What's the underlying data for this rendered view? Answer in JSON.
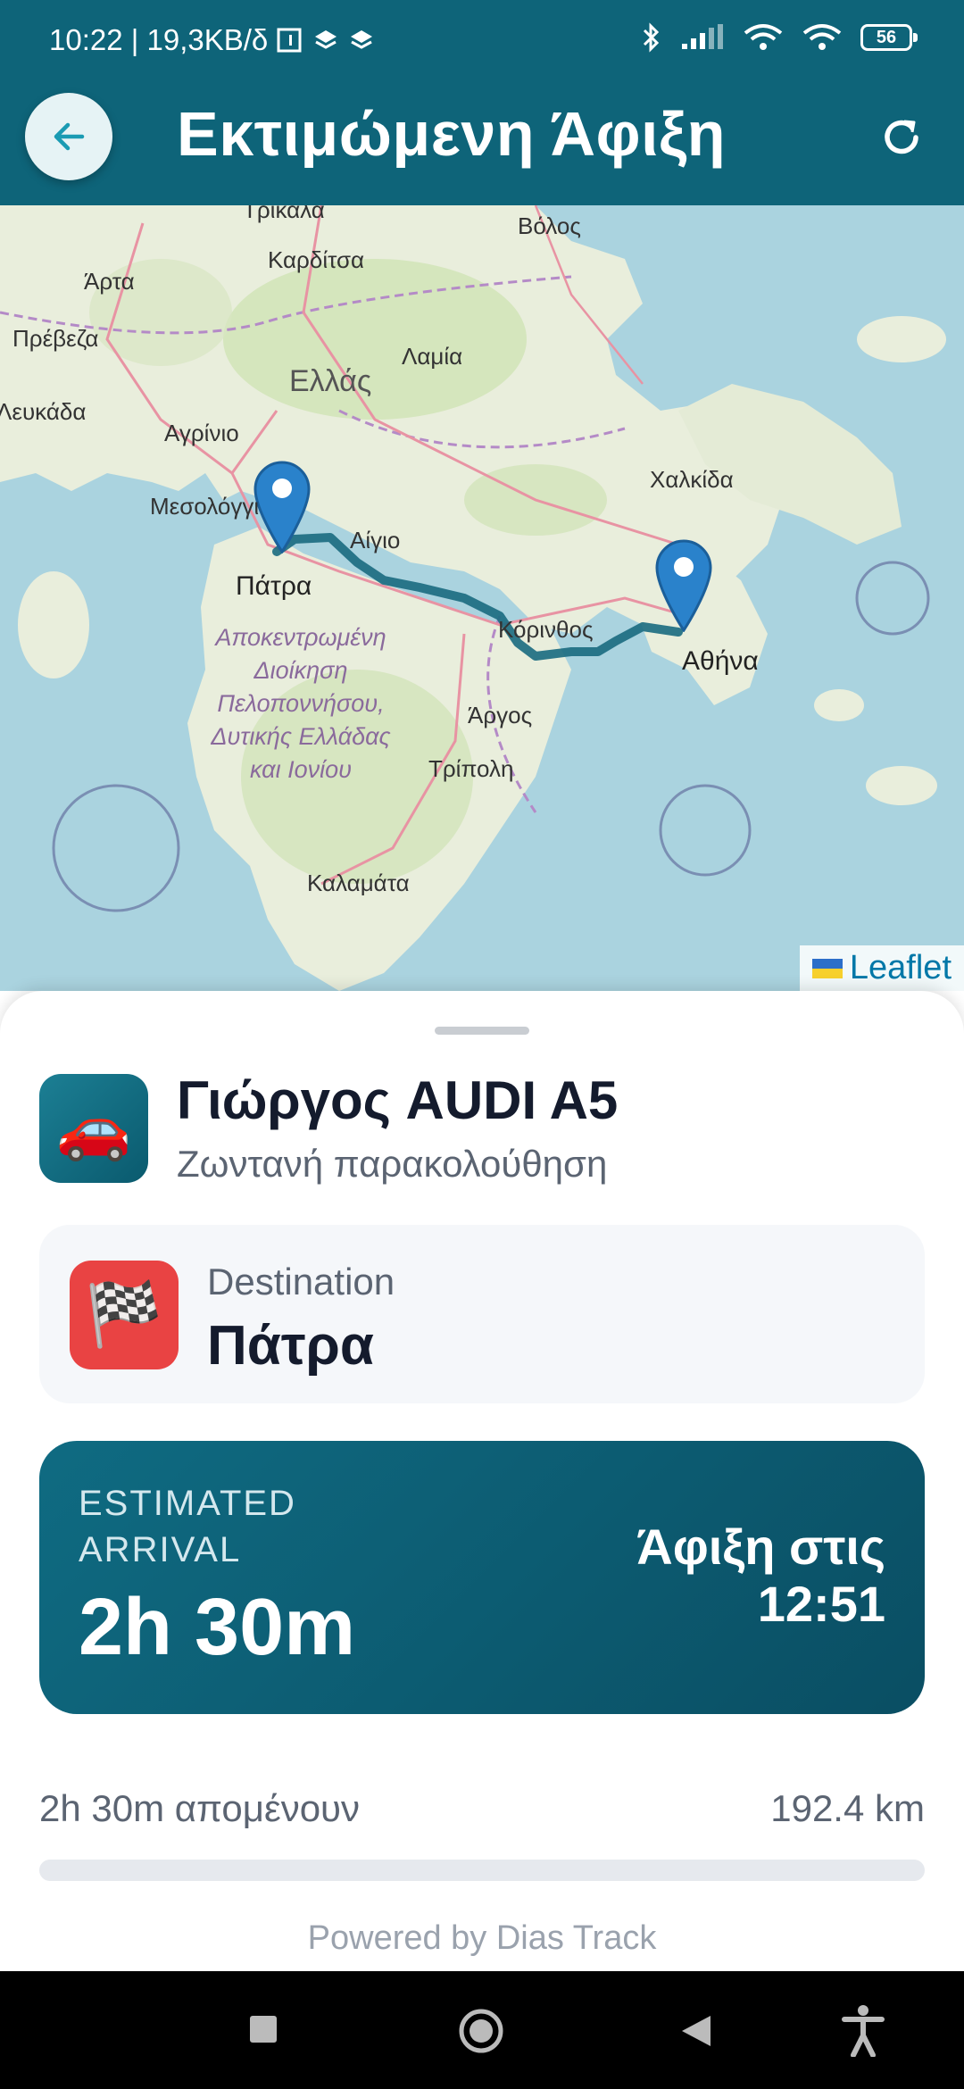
{
  "status_bar": {
    "time_speed": "10:22 | 19,3KB/δ",
    "battery": "56"
  },
  "app_bar": {
    "title": "Εκτιμώμενη Άφιξη",
    "back_icon": "arrow-left-icon",
    "refresh_icon": "refresh-icon"
  },
  "map": {
    "labels": {
      "trikala": "Τρίκαλα",
      "volos": "Βόλος",
      "karditsa": "Καρδίτσα",
      "arta": "Άρτα",
      "preveza": "Πρέβεζα",
      "lamia": "Λαμία",
      "ellas": "Ελλάς",
      "lefkada": "Λευκάδα",
      "agrinio": "Αγρίνιο",
      "chalkida": "Χαλκίδα",
      "mesolongi": "Μεσολόγγι",
      "aigio": "Αίγιο",
      "patra": "Πάτρα",
      "korinthos": "Κόρινθος",
      "athina": "Αθήνα",
      "region": "Αποκεντρωμένη Διοίκηση Πελοποννήσου, Δυτικής Ελλάδας και Ιονίου",
      "argos": "Άργος",
      "tripoli": "Τρίπολη",
      "kalamata": "Καλαμάτα"
    },
    "attribution": "Leaflet"
  },
  "vehicle": {
    "name": "Γιώργος AUDI A5",
    "subtitle": "Ζωντανή παρακολούθηση",
    "icon": "car-icon"
  },
  "destination": {
    "label": "Destination",
    "value": "Πάτρα",
    "icon": "checkered-flag-icon"
  },
  "eta": {
    "label": "ESTIMATED ARRIVAL",
    "value": "2h 30m",
    "arrive_label": "Άφιξη στις",
    "arrive_time": "12:51"
  },
  "trip": {
    "remaining": "2h 30m απομένουν",
    "distance": "192.4 km",
    "progress_percent": 0
  },
  "footer": {
    "powered_by": "Powered by Dias Track"
  },
  "colors": {
    "primary": "#0e6479",
    "route": "#1a6a80",
    "marker": "#2a82cb"
  }
}
